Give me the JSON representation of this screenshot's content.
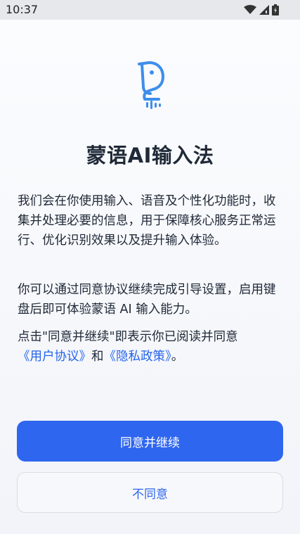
{
  "status_bar": {
    "time": "10:37",
    "icons": [
      "wifi-icon",
      "signal-icon",
      "battery-icon"
    ]
  },
  "app": {
    "title": "蒙语AI输入法",
    "logo": "horse-head-voice-logo"
  },
  "body": {
    "paragraph1": "我们会在你使用输入、语音及个性化功能时，收集并处理必要的信息，用于保障核心服务正常运行、优化识别效果以及提升输入体验。",
    "paragraph2": "你可以通过同意协议继续完成引导设置，启用键盘后即可体验蒙语 AI 输入能力。",
    "consent_prefix": "点击\"同意并继续\"即表示你已阅读并同意",
    "user_agreement_link": "《用户协议》",
    "and": "和",
    "privacy_policy_link": "《隐私政策》",
    "period": "。"
  },
  "buttons": {
    "agree_continue": "同意并继续",
    "disagree": "不同意"
  },
  "colors": {
    "accent": "#2f66ef",
    "link": "#2563eb",
    "text": "#1f2937"
  }
}
